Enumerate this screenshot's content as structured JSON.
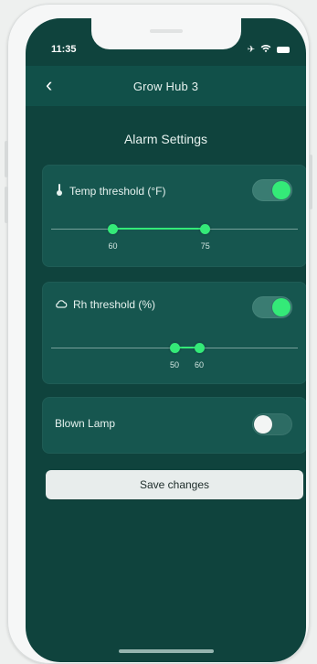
{
  "status_bar": {
    "time": "11:35",
    "icons": [
      "airplane-icon",
      "wifi-icon",
      "battery-icon"
    ]
  },
  "top_bar": {
    "title": "Grow Hub 3",
    "back_icon": "chevron-left-icon"
  },
  "section": {
    "title": "Alarm Settings"
  },
  "cards": [
    {
      "id": "temp",
      "icon": "thermometer-icon",
      "label": "Temp threshold (°F)",
      "toggle_on": true,
      "range": {
        "low": 60,
        "high": 75,
        "min": 50,
        "max": 90
      },
      "ticks": [
        "60",
        "75"
      ]
    },
    {
      "id": "rh",
      "icon": "cloud-icon",
      "label": "Rh threshold (%)",
      "toggle_on": true,
      "range": {
        "low": 50,
        "high": 60,
        "min": 0,
        "max": 100
      },
      "ticks": [
        "50",
        "60"
      ]
    },
    {
      "id": "lamp",
      "label": "Blown Lamp",
      "toggle_on": false
    }
  ],
  "actions": {
    "save_label": "Save changes"
  },
  "colors": {
    "background": "#0f433d",
    "card": "#16564f",
    "accent": "#34ea78"
  }
}
